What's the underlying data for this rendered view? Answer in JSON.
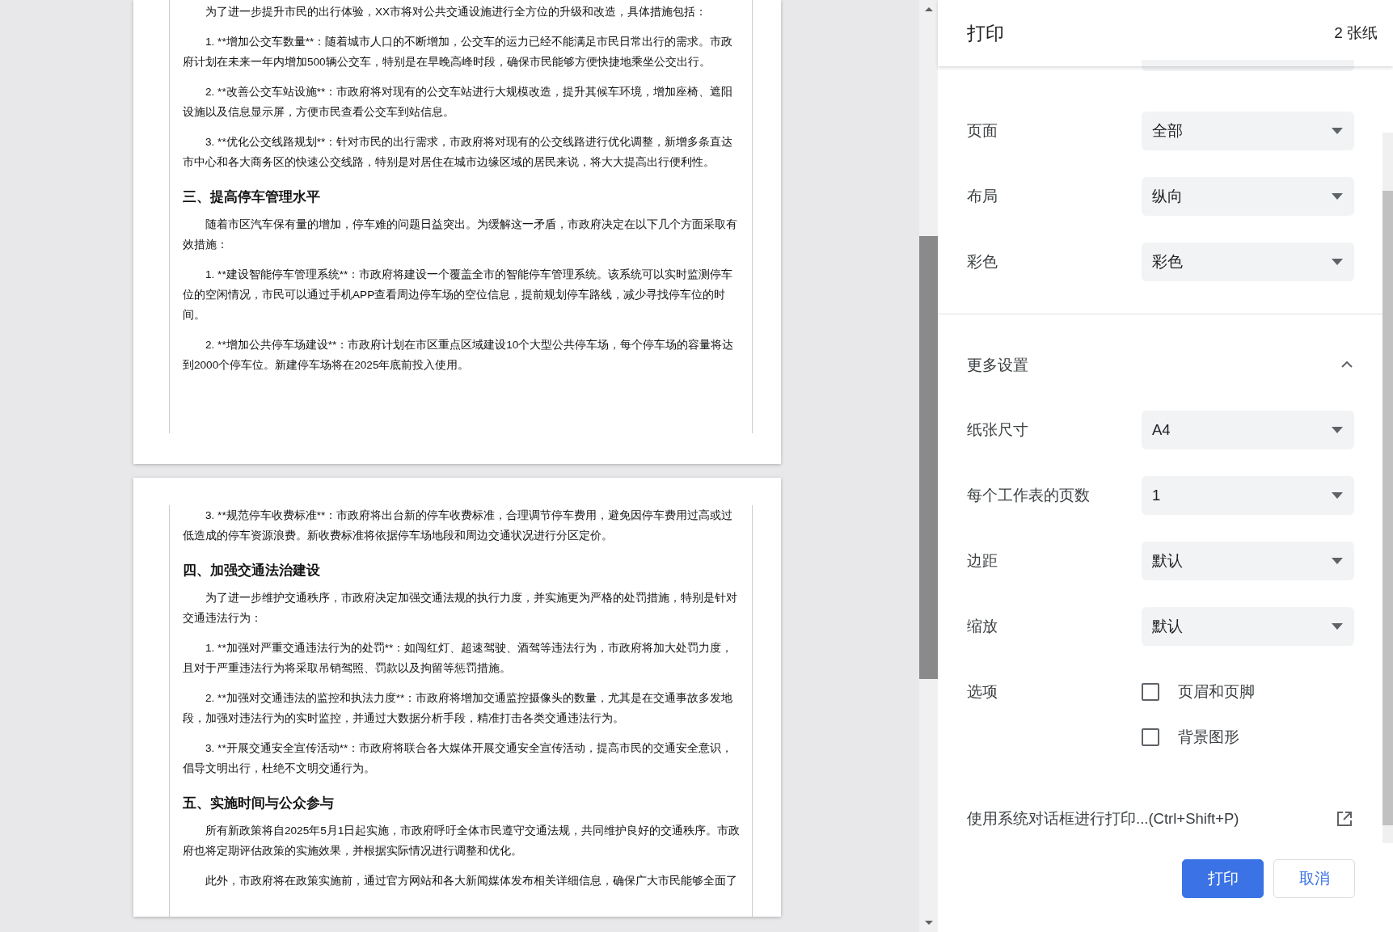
{
  "preview": {
    "pages": [
      {
        "blocks": [
          {
            "kind": "para",
            "text": "为了进一步提升市民的出行体验，XX市将对公共交通设施进行全方位的升级和改造，具体措施包括："
          },
          {
            "kind": "para",
            "text": "1. **增加公交车数量**：随着城市人口的不断增加，公交车的运力已经不能满足市民日常出行的需求。市政府计划在未来一年内增加500辆公交车，特别是在早晚高峰时段，确保市民能够方便快捷地乘坐公交出行。"
          },
          {
            "kind": "para",
            "text": "2. **改善公交车站设施**：市政府将对现有的公交车站进行大规模改造，提升其候车环境，增加座椅、遮阳设施以及信息显示屏，方便市民查看公交车到站信息。"
          },
          {
            "kind": "para",
            "text": "3. **优化公交线路规划**：针对市民的出行需求，市政府将对现有的公交线路进行优化调整，新增多条直达市中心和各大商务区的快速公交线路，特别是对居住在城市边缘区域的居民来说，将大大提高出行便利性。"
          },
          {
            "kind": "heading",
            "text": "三、提高停车管理水平"
          },
          {
            "kind": "para",
            "text": "随着市区汽车保有量的增加，停车难的问题日益突出。为缓解这一矛盾，市政府决定在以下几个方面采取有效措施："
          },
          {
            "kind": "para",
            "text": "1. **建设智能停车管理系统**：市政府将建设一个覆盖全市的智能停车管理系统。该系统可以实时监测停车位的空闲情况，市民可以通过手机APP查看周边停车场的空位信息，提前规划停车路线，减少寻找停车位的时间。"
          },
          {
            "kind": "para",
            "text": "2. **增加公共停车场建设**：市政府计划在市区重点区域建设10个大型公共停车场，每个停车场的容量将达到2000个停车位。新建停车场将在2025年底前投入使用。"
          }
        ]
      },
      {
        "blocks": [
          {
            "kind": "para",
            "text": "3. **规范停车收费标准**：市政府将出台新的停车收费标准，合理调节停车费用，避免因停车费用过高或过低造成的停车资源浪费。新收费标准将依据停车场地段和周边交通状况进行分区定价。"
          },
          {
            "kind": "heading",
            "text": "四、加强交通法治建设"
          },
          {
            "kind": "para",
            "text": "为了进一步维护交通秩序，市政府决定加强交通法规的执行力度，并实施更为严格的处罚措施，特别是针对交通违法行为："
          },
          {
            "kind": "para",
            "text": "1. **加强对严重交通违法行为的处罚**：如闯红灯、超速驾驶、酒驾等违法行为，市政府将加大处罚力度，且对于严重违法行为将采取吊销驾照、罚款以及拘留等惩罚措施。"
          },
          {
            "kind": "para",
            "text": "2. **加强对交通违法的监控和执法力度**：市政府将增加交通监控摄像头的数量，尤其是在交通事故多发地段，加强对违法行为的实时监控，并通过大数据分析手段，精准打击各类交通违法行为。"
          },
          {
            "kind": "para",
            "text": "3. **开展交通安全宣传活动**：市政府将联合各大媒体开展交通安全宣传活动，提高市民的交通安全意识，倡导文明出行，杜绝不文明交通行为。"
          },
          {
            "kind": "heading",
            "text": "五、实施时间与公众参与"
          },
          {
            "kind": "para",
            "text": "所有新政策将自2025年5月1日起实施，市政府呼吁全体市民遵守交通法规，共同维护良好的交通秩序。市政府也将定期评估政策的实施效果，并根据实际情况进行调整和优化。"
          },
          {
            "kind": "para",
            "text": "此外，市政府将在政策实施前，通过官方网站和各大新闻媒体发布相关详细信息，确保广大市民能够全面了"
          }
        ]
      }
    ]
  },
  "panel": {
    "title": "打印",
    "sheets": "2 张纸",
    "basic_settings": [
      {
        "label": "页面",
        "kind": "select",
        "value": "全部"
      },
      {
        "label": "布局",
        "kind": "select",
        "value": "纵向"
      },
      {
        "label": "彩色",
        "kind": "select",
        "value": "彩色"
      }
    ],
    "more_settings": {
      "label": "更多设置",
      "expanded": true
    },
    "advanced_settings": [
      {
        "label": "纸张尺寸",
        "kind": "select",
        "value": "A4"
      },
      {
        "label": "每个工作表的页数",
        "kind": "select",
        "value": "1"
      },
      {
        "label": "边距",
        "kind": "select",
        "value": "默认"
      },
      {
        "label": "缩放",
        "kind": "select",
        "value": "默认"
      }
    ],
    "options": {
      "label": "选项",
      "checkboxes": [
        {
          "label": "页眉和页脚",
          "checked": false
        },
        {
          "label": "背景图形",
          "checked": false
        }
      ]
    },
    "system_dialog_link": "使用系统对话框进行打印...(Ctrl+Shift+P)",
    "buttons": [
      {
        "label": "打印",
        "kind": "primary"
      },
      {
        "label": "取消",
        "kind": "secondary"
      }
    ]
  }
}
